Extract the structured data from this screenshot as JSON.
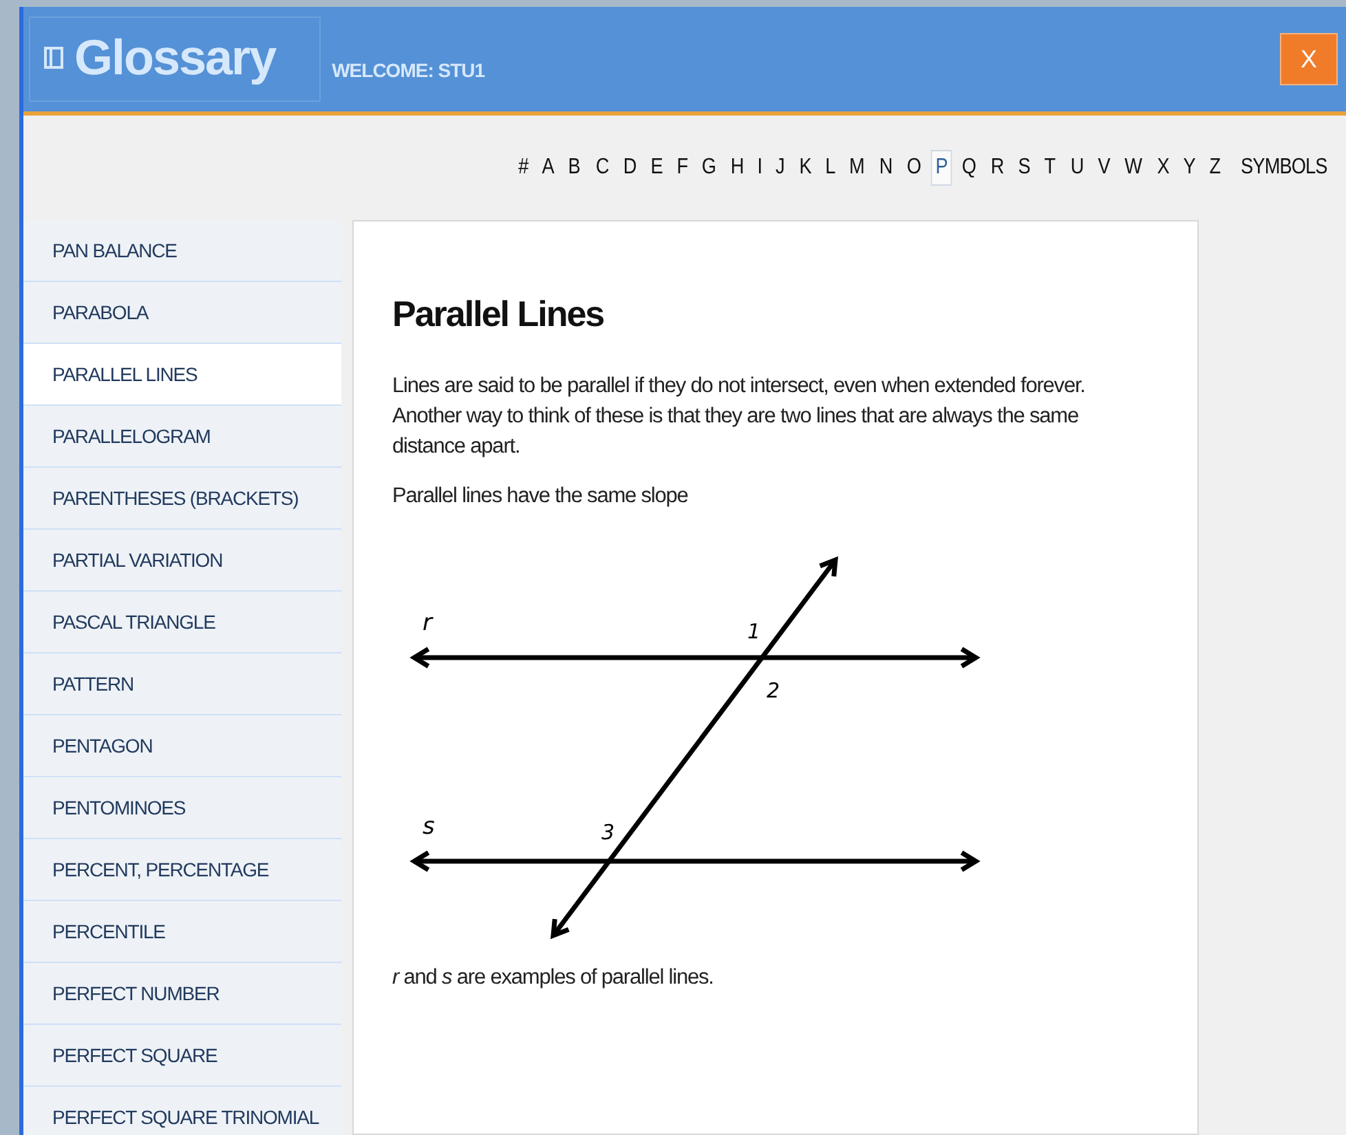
{
  "window": {
    "title": "Glossary",
    "welcome": "WELCOME: STU1",
    "close_label": "X"
  },
  "letters": [
    {
      "label": "#",
      "selected": false
    },
    {
      "label": "A",
      "selected": false
    },
    {
      "label": "B",
      "selected": false
    },
    {
      "label": "C",
      "selected": false
    },
    {
      "label": "D",
      "selected": false
    },
    {
      "label": "E",
      "selected": false
    },
    {
      "label": "F",
      "selected": false
    },
    {
      "label": "G",
      "selected": false
    },
    {
      "label": "H",
      "selected": false
    },
    {
      "label": "I",
      "selected": false
    },
    {
      "label": "J",
      "selected": false
    },
    {
      "label": "K",
      "selected": false
    },
    {
      "label": "L",
      "selected": false
    },
    {
      "label": "M",
      "selected": false
    },
    {
      "label": "N",
      "selected": false
    },
    {
      "label": "O",
      "selected": false
    },
    {
      "label": "P",
      "selected": true
    },
    {
      "label": "Q",
      "selected": false
    },
    {
      "label": "R",
      "selected": false
    },
    {
      "label": "S",
      "selected": false
    },
    {
      "label": "T",
      "selected": false
    },
    {
      "label": "U",
      "selected": false
    },
    {
      "label": "V",
      "selected": false
    },
    {
      "label": "W",
      "selected": false
    },
    {
      "label": "X",
      "selected": false
    },
    {
      "label": "Y",
      "selected": false
    },
    {
      "label": "Z",
      "selected": false
    },
    {
      "label": "SYMBOLS",
      "selected": false
    }
  ],
  "sidebar": {
    "items": [
      {
        "label": "PAN BALANCE",
        "selected": false
      },
      {
        "label": "PARABOLA",
        "selected": false
      },
      {
        "label": "PARALLEL LINES",
        "selected": true
      },
      {
        "label": "PARALLELOGRAM",
        "selected": false
      },
      {
        "label": "PARENTHESES (BRACKETS)",
        "selected": false
      },
      {
        "label": "PARTIAL VARIATION",
        "selected": false
      },
      {
        "label": "PASCAL TRIANGLE",
        "selected": false
      },
      {
        "label": "PATTERN",
        "selected": false
      },
      {
        "label": "PENTAGON",
        "selected": false
      },
      {
        "label": "PENTOMINOES",
        "selected": false
      },
      {
        "label": "PERCENT, PERCENTAGE",
        "selected": false
      },
      {
        "label": "PERCENTILE",
        "selected": false
      },
      {
        "label": "PERFECT NUMBER",
        "selected": false
      },
      {
        "label": "PERFECT SQUARE",
        "selected": false
      },
      {
        "label": "PERFECT SQUARE TRINOMIAL",
        "selected": false
      }
    ]
  },
  "entry": {
    "title": "Parallel Lines",
    "paragraphs": [
      "Lines are said to be parallel if they do not intersect, even when extended forever. Another way to think of these is that they are two lines that are always the same distance apart.",
      "Parallel lines have the same slope"
    ],
    "diagram": {
      "line_labels": [
        "r",
        "s"
      ],
      "angle_labels": [
        "1",
        "2",
        "3"
      ]
    },
    "caption": "*r* and *s* are examples of parallel lines."
  }
}
